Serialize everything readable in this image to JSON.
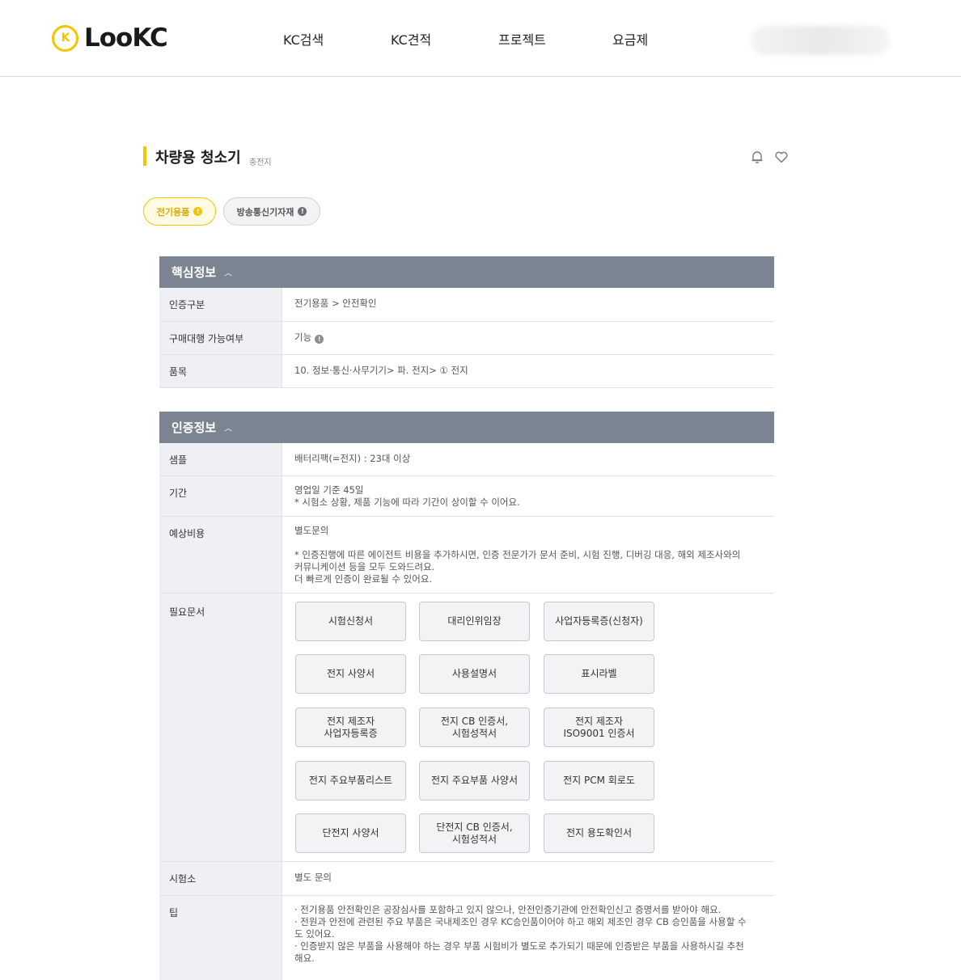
{
  "brand": {
    "logo_mark": "K",
    "name": "LooKC",
    "accent": "#f5c400"
  },
  "nav": [
    "KC검색",
    "KC견적",
    "프로젝트",
    "요금제"
  ],
  "page": {
    "title": "차량용 청소기",
    "subtitle": "충전지",
    "icons": [
      "bell-icon",
      "heart-icon"
    ]
  },
  "chips": [
    {
      "label": "전기용품",
      "icon": "info-icon",
      "active": true
    },
    {
      "label": "방송통신기자재",
      "icon": "info-icon",
      "active": false
    }
  ],
  "sections": {
    "core": {
      "title": "핵심정보",
      "rows": [
        {
          "label": "인증구분",
          "value": "전기용품 > 안전확인"
        },
        {
          "label": "구매대행 가능여부",
          "value": "기능"
        },
        {
          "label": "품목",
          "value": "10. 정보·통신·사무기기> 파. 전지> ① 전지"
        }
      ]
    },
    "cert": {
      "title": "인증정보",
      "sample": {
        "label": "샘플",
        "value": "배터리팩(=전지) : 23대 이상"
      },
      "period": {
        "label": "기간",
        "line1": "영업일 기준 45일",
        "line2": "* 시험소 상황, 제품 기능에 따라 기간이 상이할 수 이어요."
      },
      "cost": {
        "label": "예상비용",
        "line1": "별도문의",
        "line2": "* 인증진행에 따른 에이전트 비용을 추가하시면, 인증 전문가가 문서 준비, 시험 진행, 디버깅 대응, 해외 제조사와의",
        "line3": "커뮤니케이션 등을 모두 도와드려요.",
        "line4": "더 빠르게 인증이 완료될 수 있어요."
      },
      "docs": {
        "label": "필요문서",
        "items": [
          "시험신청서",
          "대리인위임장",
          "사업자등록증(신청자)",
          "전지 사양서",
          "사용설명서",
          "표시라벨",
          "전지 제조자\n사업자등록증",
          "전지 CB 인증서,\n시험성적서",
          "전지 제조자\nISO9001 인증서",
          "전지 주요부품리스트",
          "전지 주요부품 사양서",
          "전지 PCM 회로도",
          "단전지 사양서",
          "단전지 CB 인증서,\n시험성적서",
          "전지 용도확인서"
        ]
      },
      "lab": {
        "label": "시험소",
        "value": "별도 문의"
      },
      "tip": {
        "label": "팁",
        "line1": "· 전기용품 안전확인은 공장심사를 포함하고 있지 않으나, 안전인증기관에 안전확인신고 증명서를 받아야 해요.",
        "line2": "· 전원과 안전에 관련된 주요 부품은 국내제조인 경우 KC승인품이어야 하고 해외 제조인 경우 CB 승인품을 사용할 수",
        "line3": "도 있어요.",
        "line4": "· 인증받지 않은 부품을 사용해야 하는 경우 부품 시험비가 별도로 추가되기 때문에 인증받은 부품을 사용하시길 추천",
        "line5": "해요."
      }
    }
  }
}
